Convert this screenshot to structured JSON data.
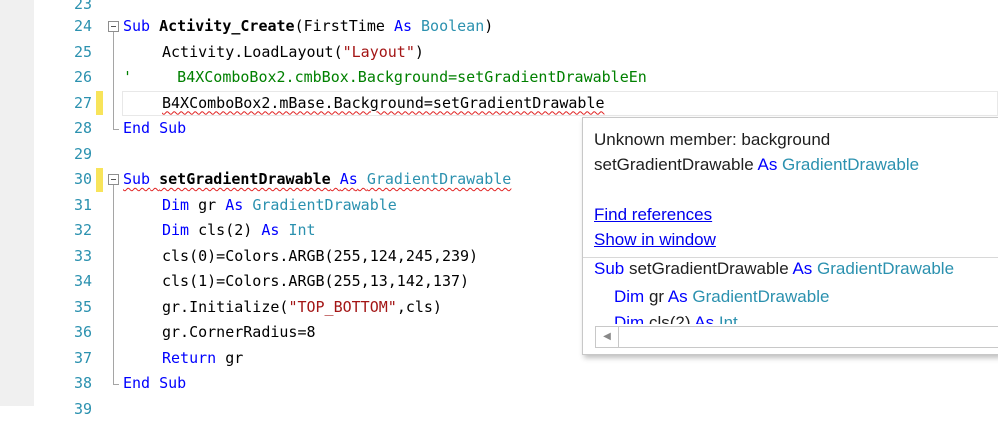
{
  "lines": [
    {
      "n": "23"
    },
    {
      "n": "24"
    },
    {
      "n": "25"
    },
    {
      "n": "26"
    },
    {
      "n": "27"
    },
    {
      "n": "28"
    },
    {
      "n": "29"
    },
    {
      "n": "30"
    },
    {
      "n": "31"
    },
    {
      "n": "32"
    },
    {
      "n": "33"
    },
    {
      "n": "34"
    },
    {
      "n": "35"
    },
    {
      "n": "36"
    },
    {
      "n": "37"
    },
    {
      "n": "38"
    },
    {
      "n": "39"
    }
  ],
  "code": {
    "l24": {
      "sub": "Sub",
      "name": "Activity_Create",
      "open": "(FirstTime ",
      "as": "As",
      "type": "Boolean",
      "close": ")"
    },
    "l25": {
      "pre": "Activity.LoadLayout(",
      "str": "\"Layout\"",
      "post": ")"
    },
    "l26": {
      "text": "'     B4XComboBox2.cmbBox.Background=setGradientDrawableEn"
    },
    "l27": {
      "text": "B4XComboBox2.mBase.Background=setGradientDrawable"
    },
    "l28": {
      "text": "End Sub"
    },
    "l30": {
      "sub": "Sub",
      "name": "setGradientDrawable",
      "as": "As",
      "type": "GradientDrawable"
    },
    "l31": {
      "dim": "Dim",
      "var": " gr ",
      "as": "As",
      "type": "GradientDrawable"
    },
    "l32": {
      "dim": "Dim",
      "var": " cls(2) ",
      "as": "As",
      "type": "Int"
    },
    "l33": {
      "text": "cls(0)=Colors.ARGB(255,124,245,239)"
    },
    "l34": {
      "text": "cls(1)=Colors.ARGB(255,13,142,137)"
    },
    "l35": {
      "pre": "gr.Initialize(",
      "str": "\"TOP_BOTTOM\"",
      "post": ",cls)"
    },
    "l36": {
      "text": "gr.CornerRadius=8"
    },
    "l37": {
      "kw": "Return",
      "post": " gr"
    },
    "l38": {
      "text": "End Sub"
    }
  },
  "popup": {
    "error": "Unknown member: background",
    "sig_name": "setGradientDrawable ",
    "sig_as": "As",
    "sig_type": " GradientDrawable",
    "find_refs": "Find references",
    "show_window": "Show in window",
    "preview": {
      "l1_sub": "Sub",
      "l1_name": " setGradientDrawable ",
      "l1_as": "As",
      "l1_type": " GradientDrawable",
      "l2_dim": "Dim",
      "l2_var": " gr ",
      "l2_as": "As",
      "l2_type": " GradientDrawable",
      "l3_dim": "Dim",
      "l3_var": " cls(2) ",
      "l3_as": "As",
      "l3_type": " Int"
    }
  },
  "colors": {
    "keyword": "#0000ff",
    "type": "#2b91af",
    "string": "#a31515",
    "comment": "#008000",
    "marker": "#f8e45a"
  }
}
